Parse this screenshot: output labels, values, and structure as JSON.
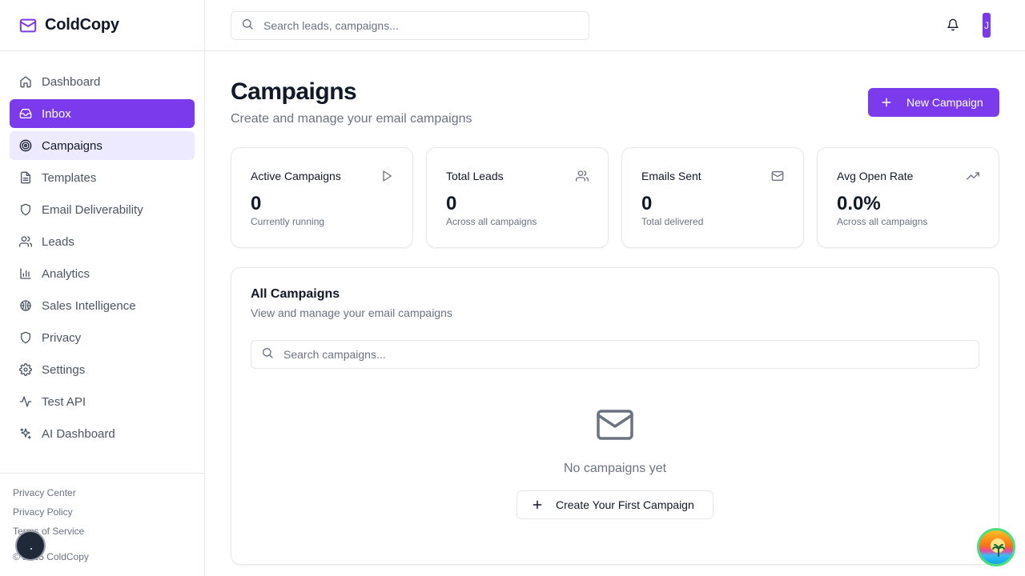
{
  "brand": {
    "name": "ColdCopy"
  },
  "search": {
    "placeholder": "Search leads, campaigns..."
  },
  "user": {
    "initial": "J"
  },
  "sidebar": {
    "items": [
      {
        "label": "Dashboard",
        "icon": "home-icon"
      },
      {
        "label": "Inbox",
        "icon": "inbox-icon",
        "state": "active"
      },
      {
        "label": "Campaigns",
        "icon": "target-icon",
        "state": "selected"
      },
      {
        "label": "Templates",
        "icon": "file-icon"
      },
      {
        "label": "Email Deliverability",
        "icon": "shield-icon"
      },
      {
        "label": "Leads",
        "icon": "users-icon"
      },
      {
        "label": "Analytics",
        "icon": "bar-chart-icon"
      },
      {
        "label": "Sales Intelligence",
        "icon": "brain-icon"
      },
      {
        "label": "Privacy",
        "icon": "shield-icon"
      },
      {
        "label": "Settings",
        "icon": "gear-icon"
      },
      {
        "label": "Test API",
        "icon": "activity-icon"
      },
      {
        "label": "AI Dashboard",
        "icon": "sparkles-icon"
      }
    ],
    "footer": {
      "links": [
        "Privacy Center",
        "Privacy Policy",
        "Terms of Service"
      ],
      "copyright": "© 2025 ColdCopy"
    }
  },
  "page": {
    "title": "Campaigns",
    "subtitle": "Create and manage your email campaigns",
    "new_button": "New Campaign"
  },
  "stats": [
    {
      "label": "Active Campaigns",
      "value": "0",
      "desc": "Currently running",
      "icon": "play-icon"
    },
    {
      "label": "Total Leads",
      "value": "0",
      "desc": "Across all campaigns",
      "icon": "users-icon"
    },
    {
      "label": "Emails Sent",
      "value": "0",
      "desc": "Total delivered",
      "icon": "mail-icon"
    },
    {
      "label": "Avg Open Rate",
      "value": "0.0%",
      "desc": "Across all campaigns",
      "icon": "trending-up-icon"
    }
  ],
  "campaigns": {
    "title": "All Campaigns",
    "subtitle": "View and manage your email campaigns",
    "search_placeholder": "Search campaigns...",
    "empty_text": "No campaigns yet",
    "create_button": "Create Your First Campaign"
  },
  "colors": {
    "accent": "#7c3aed",
    "accent_light": "#ede9fe",
    "muted": "#6b7280",
    "border": "#e5e7eb"
  }
}
